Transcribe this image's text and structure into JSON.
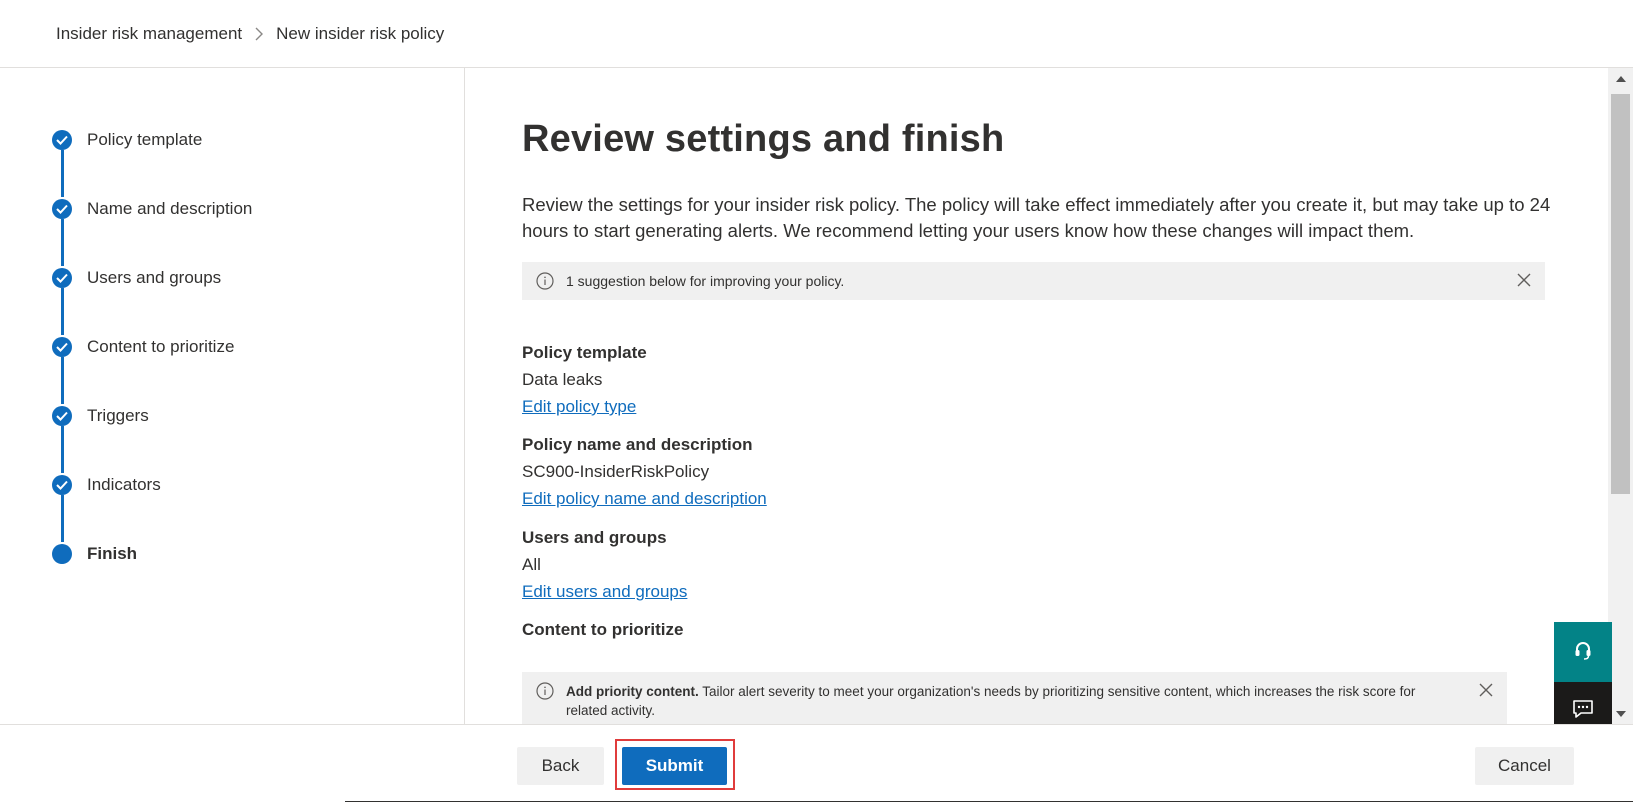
{
  "breadcrumb": {
    "parent": "Insider risk management",
    "current": "New insider risk policy"
  },
  "steps": [
    {
      "label": "Policy template",
      "status": "complete"
    },
    {
      "label": "Name and description",
      "status": "complete"
    },
    {
      "label": "Users and groups",
      "status": "complete"
    },
    {
      "label": "Content to prioritize",
      "status": "complete"
    },
    {
      "label": "Triggers",
      "status": "complete"
    },
    {
      "label": "Indicators",
      "status": "complete"
    },
    {
      "label": "Finish",
      "status": "current"
    }
  ],
  "main": {
    "title": "Review settings and finish",
    "intro": "Review the settings for your insider risk policy. The policy will take effect immediately after you create it, but may take up to 24 hours to start generating alerts. We recommend letting your users know how these changes will impact them.",
    "suggestion_banner": "1 suggestion below for improving your policy.",
    "sections": [
      {
        "title": "Policy template",
        "value": "Data leaks",
        "link": "Edit policy type"
      },
      {
        "title": "Policy name and description",
        "value": "SC900-InsiderRiskPolicy",
        "link": "Edit policy name and description"
      },
      {
        "title": "Users and groups",
        "value": "All",
        "link": "Edit users and groups"
      },
      {
        "title": "Content to prioritize"
      }
    ],
    "priority_banner": {
      "bold": "Add priority content.",
      "text": " Tailor alert severity to meet your organization's needs by prioritizing sensitive content, which increases the risk score for related activity."
    }
  },
  "footer": {
    "back_label": "Back",
    "submit_label": "Submit",
    "cancel_label": "Cancel"
  },
  "colors": {
    "accent": "#0f6cbd",
    "highlight": "#e03c3c",
    "help_button": "#038387"
  },
  "icons": {
    "step_complete": "checkmark-icon",
    "info": "info-icon",
    "close": "close-icon",
    "help": "headset-icon",
    "feedback": "chat-feedback-icon"
  }
}
